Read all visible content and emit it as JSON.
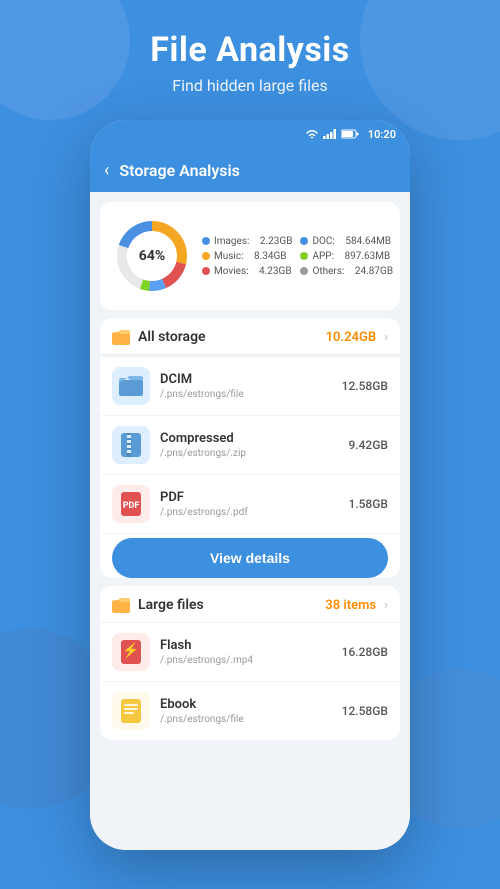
{
  "page": {
    "background_color": "#3d8fe0",
    "header": {
      "title": "File Analysis",
      "subtitle": "Find hidden large files"
    }
  },
  "phone": {
    "status_bar": {
      "time": "10:20"
    },
    "nav": {
      "back_label": "<",
      "title": "Storage Analysis"
    },
    "chart": {
      "percent_label": "64%",
      "legend": [
        {
          "label": "Images:",
          "value": "2.23GB",
          "color": "#4a90e2"
        },
        {
          "label": "DOC:",
          "value": "584.64MB",
          "color": "#4a90e2"
        },
        {
          "label": "Music:",
          "value": "8.34GB",
          "color": "#f5a623"
        },
        {
          "label": "APP:",
          "value": "897.63MB",
          "color": "#7ed321"
        },
        {
          "label": "Movies:",
          "value": "4.23GB",
          "color": "#e05252"
        },
        {
          "label": "Others:",
          "value": "24.87GB",
          "color": "#9b9b9b"
        }
      ]
    },
    "all_storage": {
      "icon_color": "#ffb347",
      "title": "All storage",
      "size": "10.24GB",
      "files": [
        {
          "name": "DCIM",
          "path": "/.pns/estrongs/file",
          "size": "12.58GB",
          "icon_color": "#5b9bd5",
          "icon": "folder"
        },
        {
          "name": "Compressed",
          "path": "/.pns/estrongs/.zip",
          "size": "9.42GB",
          "icon_color": "#5b9bd5",
          "icon": "zip"
        },
        {
          "name": "PDF",
          "path": "/.pns/estrongs/.pdf",
          "size": "1.58GB",
          "icon_color": "#e05252",
          "icon": "pdf"
        }
      ],
      "view_details_label": "View details"
    },
    "large_files": {
      "icon_color": "#ffb347",
      "title": "Large files",
      "count": "38 items",
      "files": [
        {
          "name": "Flash",
          "path": "/.pns/estrongs/.mp4",
          "size": "16.28GB",
          "icon_color": "#e05252",
          "icon": "flash"
        },
        {
          "name": "Ebook",
          "path": "/.pns/estrongs/file",
          "size": "12.58GB",
          "icon_color": "#f5c842",
          "icon": "ebook"
        }
      ]
    }
  },
  "icons": {
    "folder_unicode": "📁",
    "zip_unicode": "🗜",
    "pdf_unicode": "📄",
    "flash_unicode": "⚡",
    "ebook_unicode": "📒"
  }
}
